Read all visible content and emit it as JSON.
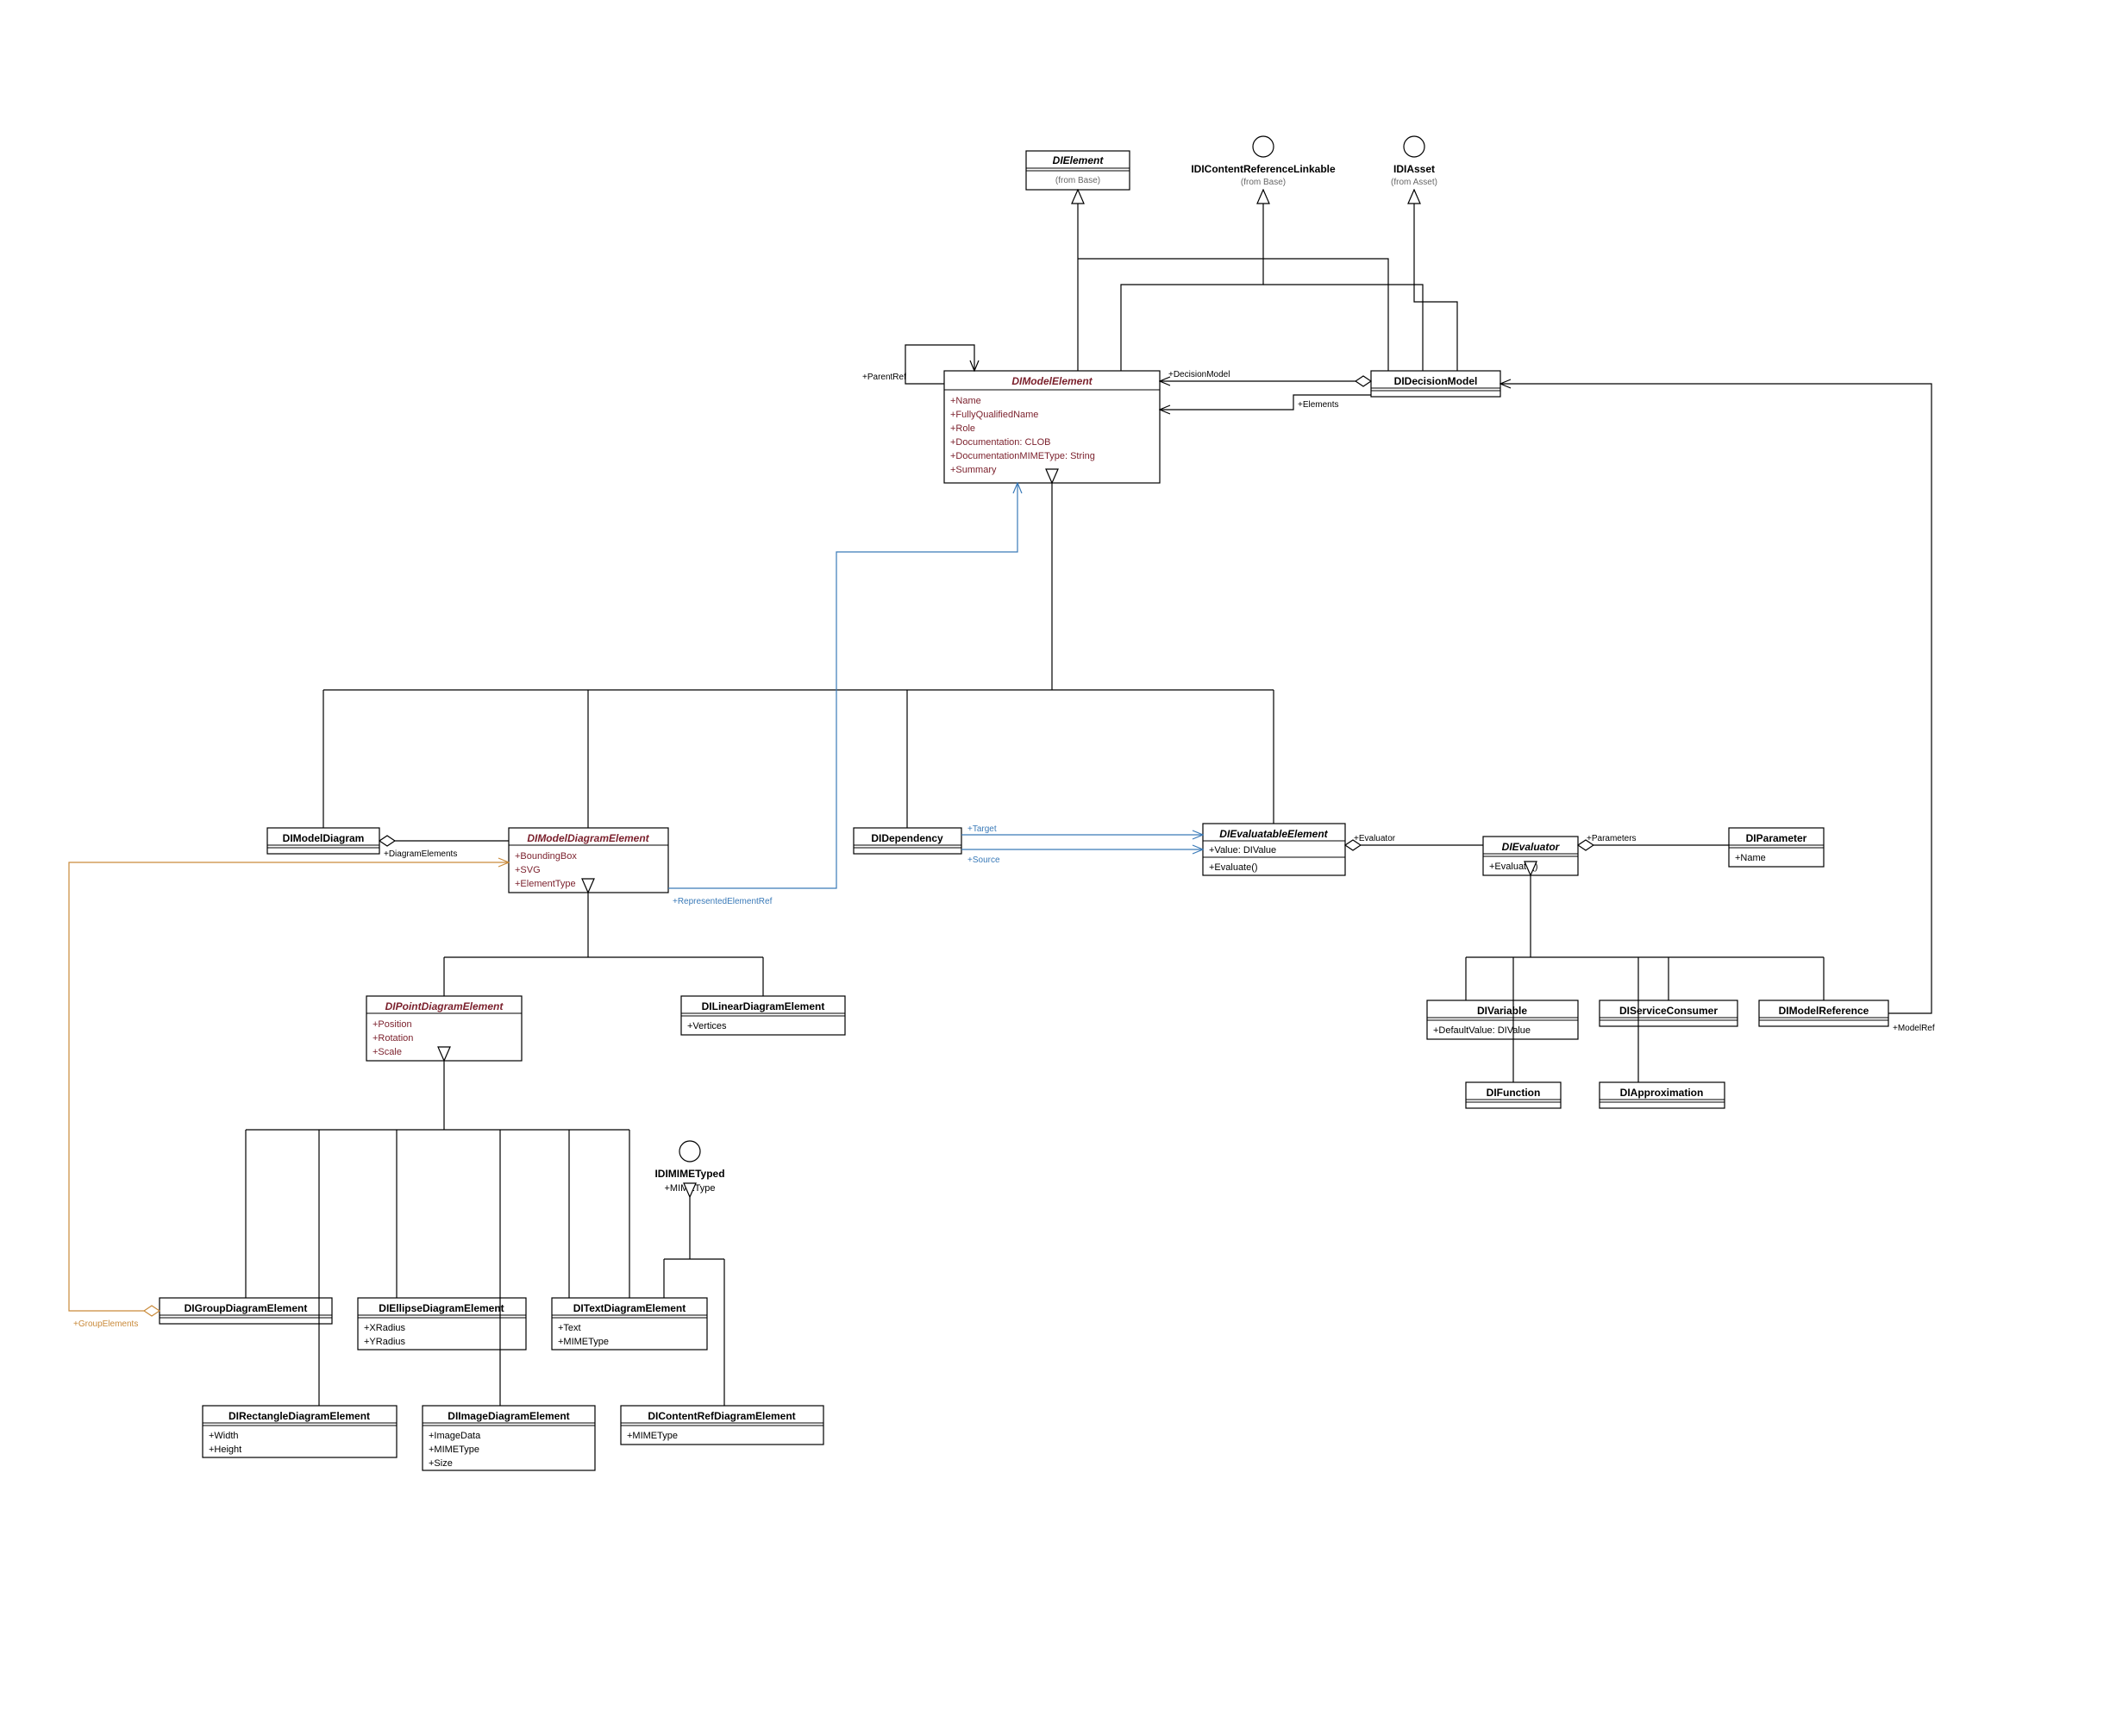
{
  "diagram_type": "UML Class Diagram",
  "interfaces": {
    "IDIContentReferenceLinkable": {
      "name": "IDIContentReferenceLinkable",
      "from": "(from Base)"
    },
    "IDIAsset": {
      "name": "IDIAsset",
      "from": "(from Asset)"
    },
    "IDIMIMETyped": {
      "name": "IDIMIMETyped",
      "attr": "+MIMEType"
    }
  },
  "classes": {
    "DIElement": {
      "name": "DIElement",
      "from": "(from Base)"
    },
    "DIModelElement": {
      "name": "DIModelElement",
      "attrs": [
        "+Name",
        "+FullyQualifiedName",
        "+Role",
        "+Documentation: CLOB",
        "+DocumentationMIMEType: String",
        "+Summary"
      ]
    },
    "DIDecisionModel": {
      "name": "DIDecisionModel"
    },
    "DIModelDiagram": {
      "name": "DIModelDiagram"
    },
    "DIModelDiagramElement": {
      "name": "DIModelDiagramElement",
      "attrs": [
        "+BoundingBox",
        "+SVG",
        "+ElementType"
      ]
    },
    "DIDependency": {
      "name": "DIDependency"
    },
    "DIEvaluatableElement": {
      "name": "DIEvaluatableElement",
      "attrs": [
        "+Value: DIValue"
      ],
      "ops": [
        "+Evaluate()"
      ]
    },
    "DIEvaluator": {
      "name": "DIEvaluator",
      "ops": [
        "+Evaluate()"
      ]
    },
    "DIParameter": {
      "name": "DIParameter",
      "attrs": [
        "+Name"
      ]
    },
    "DIVariable": {
      "name": "DIVariable",
      "attrs": [
        "+DefaultValue: DIValue"
      ]
    },
    "DIServiceConsumer": {
      "name": "DIServiceConsumer"
    },
    "DIModelReference": {
      "name": "DIModelReference"
    },
    "DIFunction": {
      "name": "DIFunction"
    },
    "DIApproximation": {
      "name": "DIApproximation"
    },
    "DIPointDiagramElement": {
      "name": "DIPointDiagramElement",
      "attrs": [
        "+Position",
        "+Rotation",
        "+Scale"
      ]
    },
    "DILinearDiagramElement": {
      "name": "DILinearDiagramElement",
      "attrs": [
        "+Vertices"
      ]
    },
    "DIGroupDiagramElement": {
      "name": "DIGroupDiagramElement"
    },
    "DIEllipseDiagramElement": {
      "name": "DIEllipseDiagramElement",
      "attrs": [
        "+XRadius",
        "+YRadius"
      ]
    },
    "DITextDiagramElement": {
      "name": "DITextDiagramElement",
      "attrs": [
        "+Text",
        "+MIMEType"
      ]
    },
    "DIRectangleDiagramElement": {
      "name": "DIRectangleDiagramElement",
      "attrs": [
        "+Width",
        "+Height"
      ]
    },
    "DIImageDiagramElement": {
      "name": "DIImageDiagramElement",
      "attrs": [
        "+ImageData",
        "+MIMEType",
        "+Size"
      ]
    },
    "DIContentRefDiagramElement": {
      "name": "DIContentRefDiagramElement",
      "attrs": [
        "+MIMEType"
      ]
    }
  },
  "association_labels": {
    "ParentRef": "+ParentRef",
    "DecisionModel": "+DecisionModel",
    "Elements": "+Elements",
    "DiagramElements": "+DiagramElements",
    "RepresentedElementRef": "+RepresentedElementRef",
    "Target": "+Target",
    "Source": "+Source",
    "Evaluator": "+Evaluator",
    "Parameters": "+Parameters",
    "ModelRef": "+ModelRef",
    "GroupElements": "+GroupElements"
  }
}
